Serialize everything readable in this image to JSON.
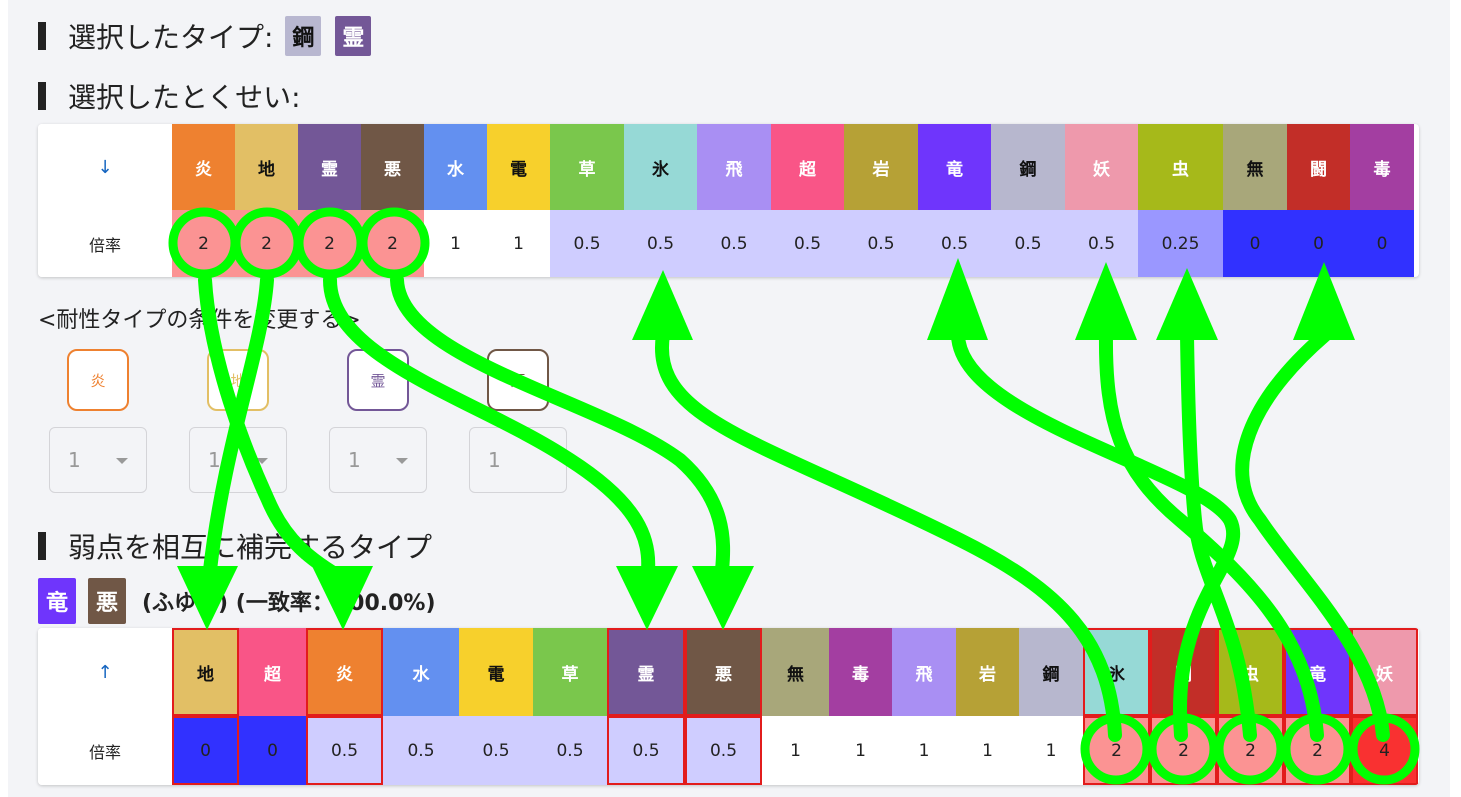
{
  "selected_types": {
    "heading": "選択したタイプ:",
    "types": [
      {
        "name": "鋼",
        "bg": "#b8b7d0",
        "fg": "#111111"
      },
      {
        "name": "霊",
        "bg": "#735797",
        "fg": "#ffffff"
      }
    ]
  },
  "selected_ability": {
    "heading": "選択したとくせい:"
  },
  "table1": {
    "sort_arrow": "↓",
    "row_label": "倍率",
    "columns": [
      {
        "type": "炎",
        "bg": "#ee8130",
        "fg": "#ffffff",
        "value": "2",
        "vbg": "#fb9393",
        "vfg": "#222222"
      },
      {
        "type": "地",
        "bg": "#e2bf65",
        "fg": "#111111",
        "value": "2",
        "vbg": "#fb9393",
        "vfg": "#222222"
      },
      {
        "type": "霊",
        "bg": "#735797",
        "fg": "#ffffff",
        "value": "2",
        "vbg": "#fb9393",
        "vfg": "#222222"
      },
      {
        "type": "悪",
        "bg": "#705746",
        "fg": "#ffffff",
        "value": "2",
        "vbg": "#fb9393",
        "vfg": "#222222"
      },
      {
        "type": "水",
        "bg": "#6390f0",
        "fg": "#ffffff",
        "value": "1",
        "vbg": "#ffffff",
        "vfg": "#222222"
      },
      {
        "type": "電",
        "bg": "#f7d02c",
        "fg": "#111111",
        "value": "1",
        "vbg": "#ffffff",
        "vfg": "#222222"
      },
      {
        "type": "草",
        "bg": "#7ac74c",
        "fg": "#ffffff",
        "value": "0.5",
        "vbg": "#cfcdff",
        "vfg": "#222222"
      },
      {
        "type": "氷",
        "bg": "#96d9d6",
        "fg": "#111111",
        "value": "0.5",
        "vbg": "#cfcdff",
        "vfg": "#222222"
      },
      {
        "type": "飛",
        "bg": "#a98ff3",
        "fg": "#ffffff",
        "value": "0.5",
        "vbg": "#cfcdff",
        "vfg": "#222222"
      },
      {
        "type": "超",
        "bg": "#f95587",
        "fg": "#ffffff",
        "value": "0.5",
        "vbg": "#cfcdff",
        "vfg": "#222222"
      },
      {
        "type": "岩",
        "bg": "#b6a136",
        "fg": "#ffffff",
        "value": "0.5",
        "vbg": "#cfcdff",
        "vfg": "#222222"
      },
      {
        "type": "竜",
        "bg": "#6f35fc",
        "fg": "#ffffff",
        "value": "0.5",
        "vbg": "#cfcdff",
        "vfg": "#222222"
      },
      {
        "type": "鋼",
        "bg": "#b7b7ce",
        "fg": "#111111",
        "value": "0.5",
        "vbg": "#cfcdff",
        "vfg": "#222222"
      },
      {
        "type": "妖",
        "bg": "#ee99ac",
        "fg": "#ffffff",
        "value": "0.5",
        "vbg": "#cfcdff",
        "vfg": "#222222"
      },
      {
        "type": "虫",
        "bg": "#a6b91a",
        "fg": "#ffffff",
        "value": "0.25",
        "vbg": "#9a97ff",
        "vfg": "#222222"
      },
      {
        "type": "無",
        "bg": "#a8a77a",
        "fg": "#111111",
        "value": "0",
        "vbg": "#3131ff",
        "vfg": "#222222"
      },
      {
        "type": "闘",
        "bg": "#c22e28",
        "fg": "#ffffff",
        "value": "0",
        "vbg": "#3131ff",
        "vfg": "#222222"
      },
      {
        "type": "毒",
        "bg": "#a33ea1",
        "fg": "#ffffff",
        "value": "0",
        "vbg": "#3131ff",
        "vfg": "#222222"
      }
    ]
  },
  "resistance_conditions": {
    "title": "<耐性タイプの条件を変更する>",
    "items": [
      {
        "type": "炎",
        "color": "#ee8130",
        "value": "1"
      },
      {
        "type": "地",
        "color": "#e2bf65",
        "value": "1"
      },
      {
        "type": "霊",
        "color": "#735797",
        "value": "1"
      },
      {
        "type": "悪",
        "color": "#705746",
        "value": "1"
      }
    ]
  },
  "complement": {
    "heading": "弱点を相互に補完するタイプ",
    "types": [
      {
        "name": "竜",
        "bg": "#6f35fc"
      },
      {
        "name": "悪",
        "bg": "#705746"
      }
    ],
    "detail": "(ふゆう) (一致率：100.0%)"
  },
  "table2": {
    "sort_arrow": "↑",
    "row_label": "倍率",
    "columns": [
      {
        "type": "地",
        "bg": "#e2bf65",
        "fg": "#111111",
        "value": "0",
        "vbg": "#3131ff",
        "vfg": "#222222",
        "highlight": true
      },
      {
        "type": "超",
        "bg": "#f95587",
        "fg": "#ffffff",
        "value": "0",
        "vbg": "#3131ff",
        "vfg": "#222222",
        "highlight": false
      },
      {
        "type": "炎",
        "bg": "#ee8130",
        "fg": "#ffffff",
        "value": "0.5",
        "vbg": "#cfcdff",
        "vfg": "#222222",
        "highlight": true
      },
      {
        "type": "水",
        "bg": "#6390f0",
        "fg": "#ffffff",
        "value": "0.5",
        "vbg": "#cfcdff",
        "vfg": "#222222",
        "highlight": false
      },
      {
        "type": "電",
        "bg": "#f7d02c",
        "fg": "#111111",
        "value": "0.5",
        "vbg": "#cfcdff",
        "vfg": "#222222",
        "highlight": false
      },
      {
        "type": "草",
        "bg": "#7ac74c",
        "fg": "#ffffff",
        "value": "0.5",
        "vbg": "#cfcdff",
        "vfg": "#222222",
        "highlight": false
      },
      {
        "type": "霊",
        "bg": "#735797",
        "fg": "#ffffff",
        "value": "0.5",
        "vbg": "#cfcdff",
        "vfg": "#222222",
        "highlight": true
      },
      {
        "type": "悪",
        "bg": "#705746",
        "fg": "#ffffff",
        "value": "0.5",
        "vbg": "#cfcdff",
        "vfg": "#222222",
        "highlight": true
      },
      {
        "type": "無",
        "bg": "#a8a77a",
        "fg": "#111111",
        "value": "1",
        "vbg": "#ffffff",
        "vfg": "#222222",
        "highlight": false
      },
      {
        "type": "毒",
        "bg": "#a33ea1",
        "fg": "#ffffff",
        "value": "1",
        "vbg": "#ffffff",
        "vfg": "#222222",
        "highlight": false
      },
      {
        "type": "飛",
        "bg": "#a98ff3",
        "fg": "#ffffff",
        "value": "1",
        "vbg": "#ffffff",
        "vfg": "#222222",
        "highlight": false
      },
      {
        "type": "岩",
        "bg": "#b6a136",
        "fg": "#ffffff",
        "value": "1",
        "vbg": "#ffffff",
        "vfg": "#222222",
        "highlight": false
      },
      {
        "type": "鋼",
        "bg": "#b7b7ce",
        "fg": "#111111",
        "value": "1",
        "vbg": "#ffffff",
        "vfg": "#222222",
        "highlight": false
      },
      {
        "type": "氷",
        "bg": "#96d9d6",
        "fg": "#111111",
        "value": "2",
        "vbg": "#fb9393",
        "vfg": "#222222",
        "highlight": true
      },
      {
        "type": "闘",
        "bg": "#c22e28",
        "fg": "#ffffff",
        "value": "2",
        "vbg": "#fb9393",
        "vfg": "#222222",
        "highlight": true
      },
      {
        "type": "虫",
        "bg": "#a6b91a",
        "fg": "#ffffff",
        "value": "2",
        "vbg": "#fb9393",
        "vfg": "#222222",
        "highlight": true
      },
      {
        "type": "竜",
        "bg": "#6f35fc",
        "fg": "#ffffff",
        "value": "2",
        "vbg": "#fb9393",
        "vfg": "#222222",
        "highlight": true
      },
      {
        "type": "妖",
        "bg": "#ee99ac",
        "fg": "#ffffff",
        "value": "4",
        "vbg": "#f93131",
        "vfg": "#222222",
        "highlight": true
      }
    ]
  },
  "annotation_color": "#00ff00"
}
